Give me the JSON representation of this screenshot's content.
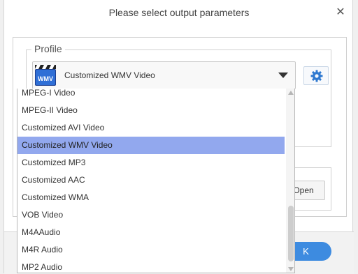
{
  "dialog": {
    "title": "Please select output parameters"
  },
  "profile": {
    "legend": "Profile",
    "selected": "Customized WMV Video",
    "icon_text": "WMV"
  },
  "buttons": {
    "open_label": "Open",
    "ok_label": "K"
  },
  "dropdown": {
    "items": [
      "MPEG-I Video",
      "MPEG-II Video",
      "Customized AVI Video",
      "Customized WMV Video",
      "Customized MP3",
      "Customized AAC",
      "Customized WMA",
      "VOB Video",
      "M4AAudio",
      "M4R Audio",
      "MP2 Audio"
    ],
    "selected_index": 3
  },
  "colors": {
    "selection": "#92a8ee",
    "accent": "#3d8be0"
  }
}
